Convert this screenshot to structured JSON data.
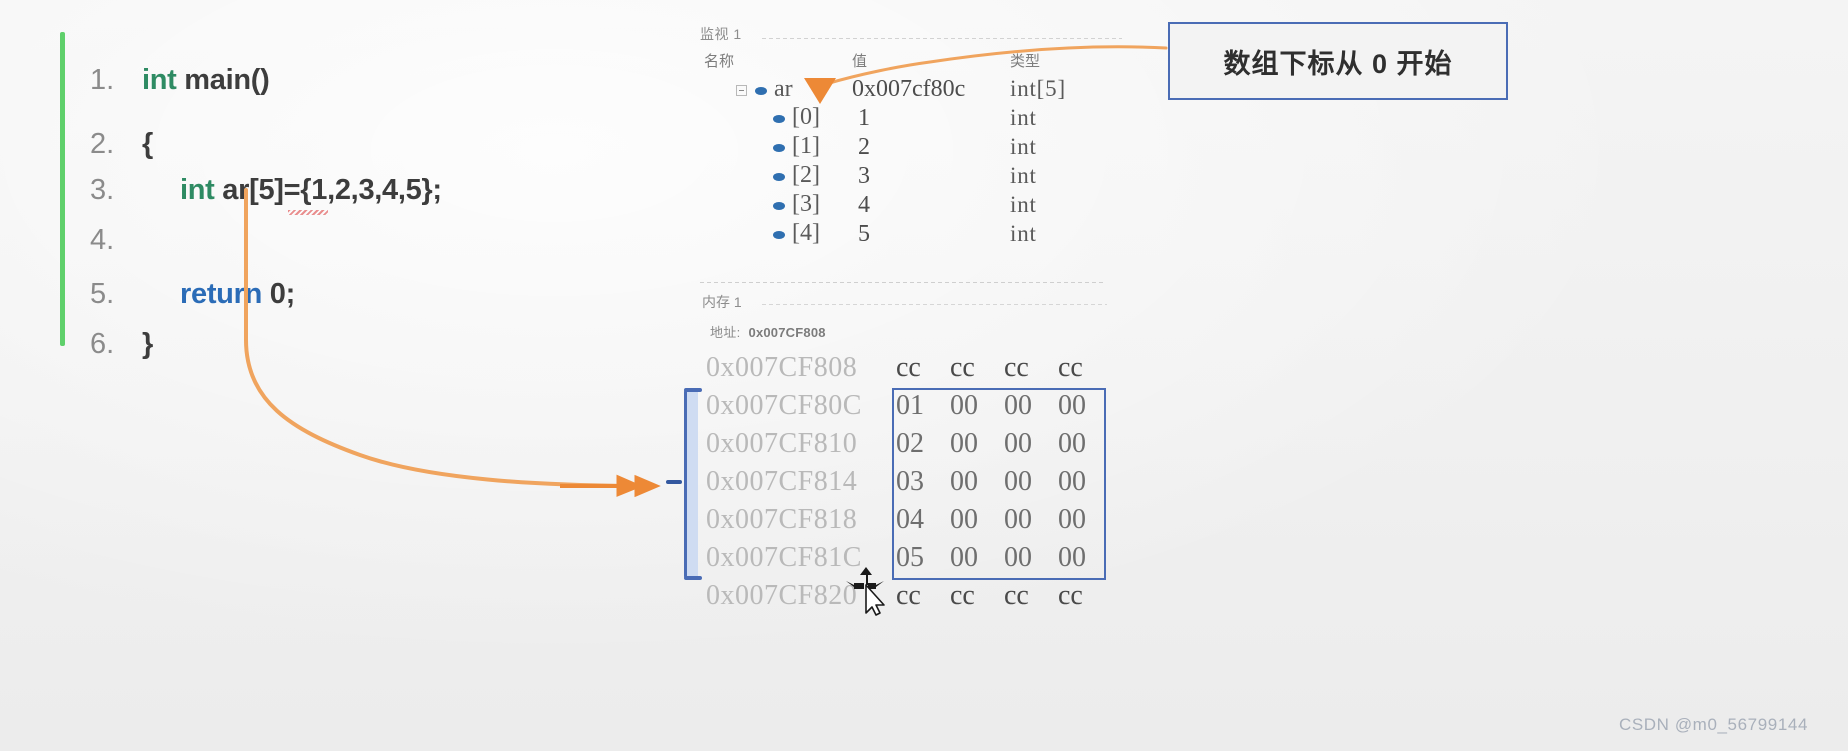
{
  "code": {
    "green_marker": "change-bar",
    "lines": [
      {
        "num": "1.",
        "indent": false,
        "tokens": [
          {
            "t": "int",
            "c": "kw-int"
          },
          {
            "t": " main()",
            "c": "plain"
          }
        ]
      },
      {
        "num": "2.",
        "indent": false,
        "tokens": [
          {
            "t": "{",
            "c": "plain"
          }
        ]
      },
      {
        "num": "3.",
        "indent": true,
        "tokens": [
          {
            "t": "int",
            "c": "kw-int"
          },
          {
            "t": " ar[5]",
            "c": "plain"
          },
          {
            "t": "=",
            "c": "plain"
          },
          {
            "t": "{1,2,3,4,5};",
            "c": "plain"
          }
        ]
      },
      {
        "num": "4.",
        "indent": false,
        "tokens": []
      },
      {
        "num": "5.",
        "indent": true,
        "tokens": [
          {
            "t": "return",
            "c": "kw-ret"
          },
          {
            "t": " 0;",
            "c": "plain"
          }
        ]
      },
      {
        "num": "6.",
        "indent": false,
        "tokens": [
          {
            "t": "}",
            "c": "plain"
          }
        ]
      }
    ],
    "line1_num": "1.",
    "line1_kw": "int",
    "line1_rest": " main()",
    "line2_num": "2.",
    "line2_text": "{",
    "line3_num": "3.",
    "line3_kw": "int",
    "line3_rest": " ar[5]={1,2,3,4,5};",
    "line4_num": "4.",
    "line4_text": "",
    "line5_num": "5.",
    "line5_kw": "return",
    "line5_rest": " 0;",
    "line6_num": "6.",
    "line6_text": "}"
  },
  "watch": {
    "tab_label": "监视 1",
    "columns": {
      "name": "名称",
      "value": "值",
      "type": "类型"
    },
    "rows": [
      {
        "name": "ar",
        "value": "0x007cf80c",
        "type": "int[5]",
        "level": 0,
        "expanded": true
      },
      {
        "name": "[0]",
        "value": "1",
        "type": "int",
        "level": 1
      },
      {
        "name": "[1]",
        "value": "2",
        "type": "int",
        "level": 1
      },
      {
        "name": "[2]",
        "value": "3",
        "type": "int",
        "level": 1
      },
      {
        "name": "[3]",
        "value": "4",
        "type": "int",
        "level": 1
      },
      {
        "name": "[4]",
        "value": "5",
        "type": "int",
        "level": 1
      }
    ]
  },
  "memory": {
    "tab_label": "内存 1",
    "address_label": "地址:",
    "address_value": "0x007CF808",
    "rows": [
      {
        "address": "0x007CF808",
        "bytes": [
          "cc",
          "cc",
          "cc",
          "cc"
        ],
        "highlight": false
      },
      {
        "address": "0x007CF80C",
        "bytes": [
          "01",
          "00",
          "00",
          "00"
        ],
        "highlight": true
      },
      {
        "address": "0x007CF810",
        "bytes": [
          "02",
          "00",
          "00",
          "00"
        ],
        "highlight": true
      },
      {
        "address": "0x007CF814",
        "bytes": [
          "03",
          "00",
          "00",
          "00"
        ],
        "highlight": true
      },
      {
        "address": "0x007CF818",
        "bytes": [
          "04",
          "00",
          "00",
          "00"
        ],
        "highlight": true
      },
      {
        "address": "0x007CF81C",
        "bytes": [
          "05",
          "00",
          "00",
          "00"
        ],
        "highlight": true
      },
      {
        "address": "0x007CF820",
        "bytes": [
          "cc",
          "cc",
          "cc",
          "cc"
        ],
        "highlight": false
      }
    ]
  },
  "annotation": {
    "text": "数组下标从 0 开始",
    "border_color": "#4a6cb5"
  },
  "colors": {
    "accent_orange": "#ed8936",
    "accent_blue": "#4a6cb5",
    "keyword_green": "#2e8b63",
    "keyword_blue": "#2b6cb7",
    "change_bar_green": "#5fd06b"
  },
  "watermark": {
    "text": "CSDN @m0_56799144"
  },
  "cursor": {
    "type": "move-resize-cursor"
  }
}
